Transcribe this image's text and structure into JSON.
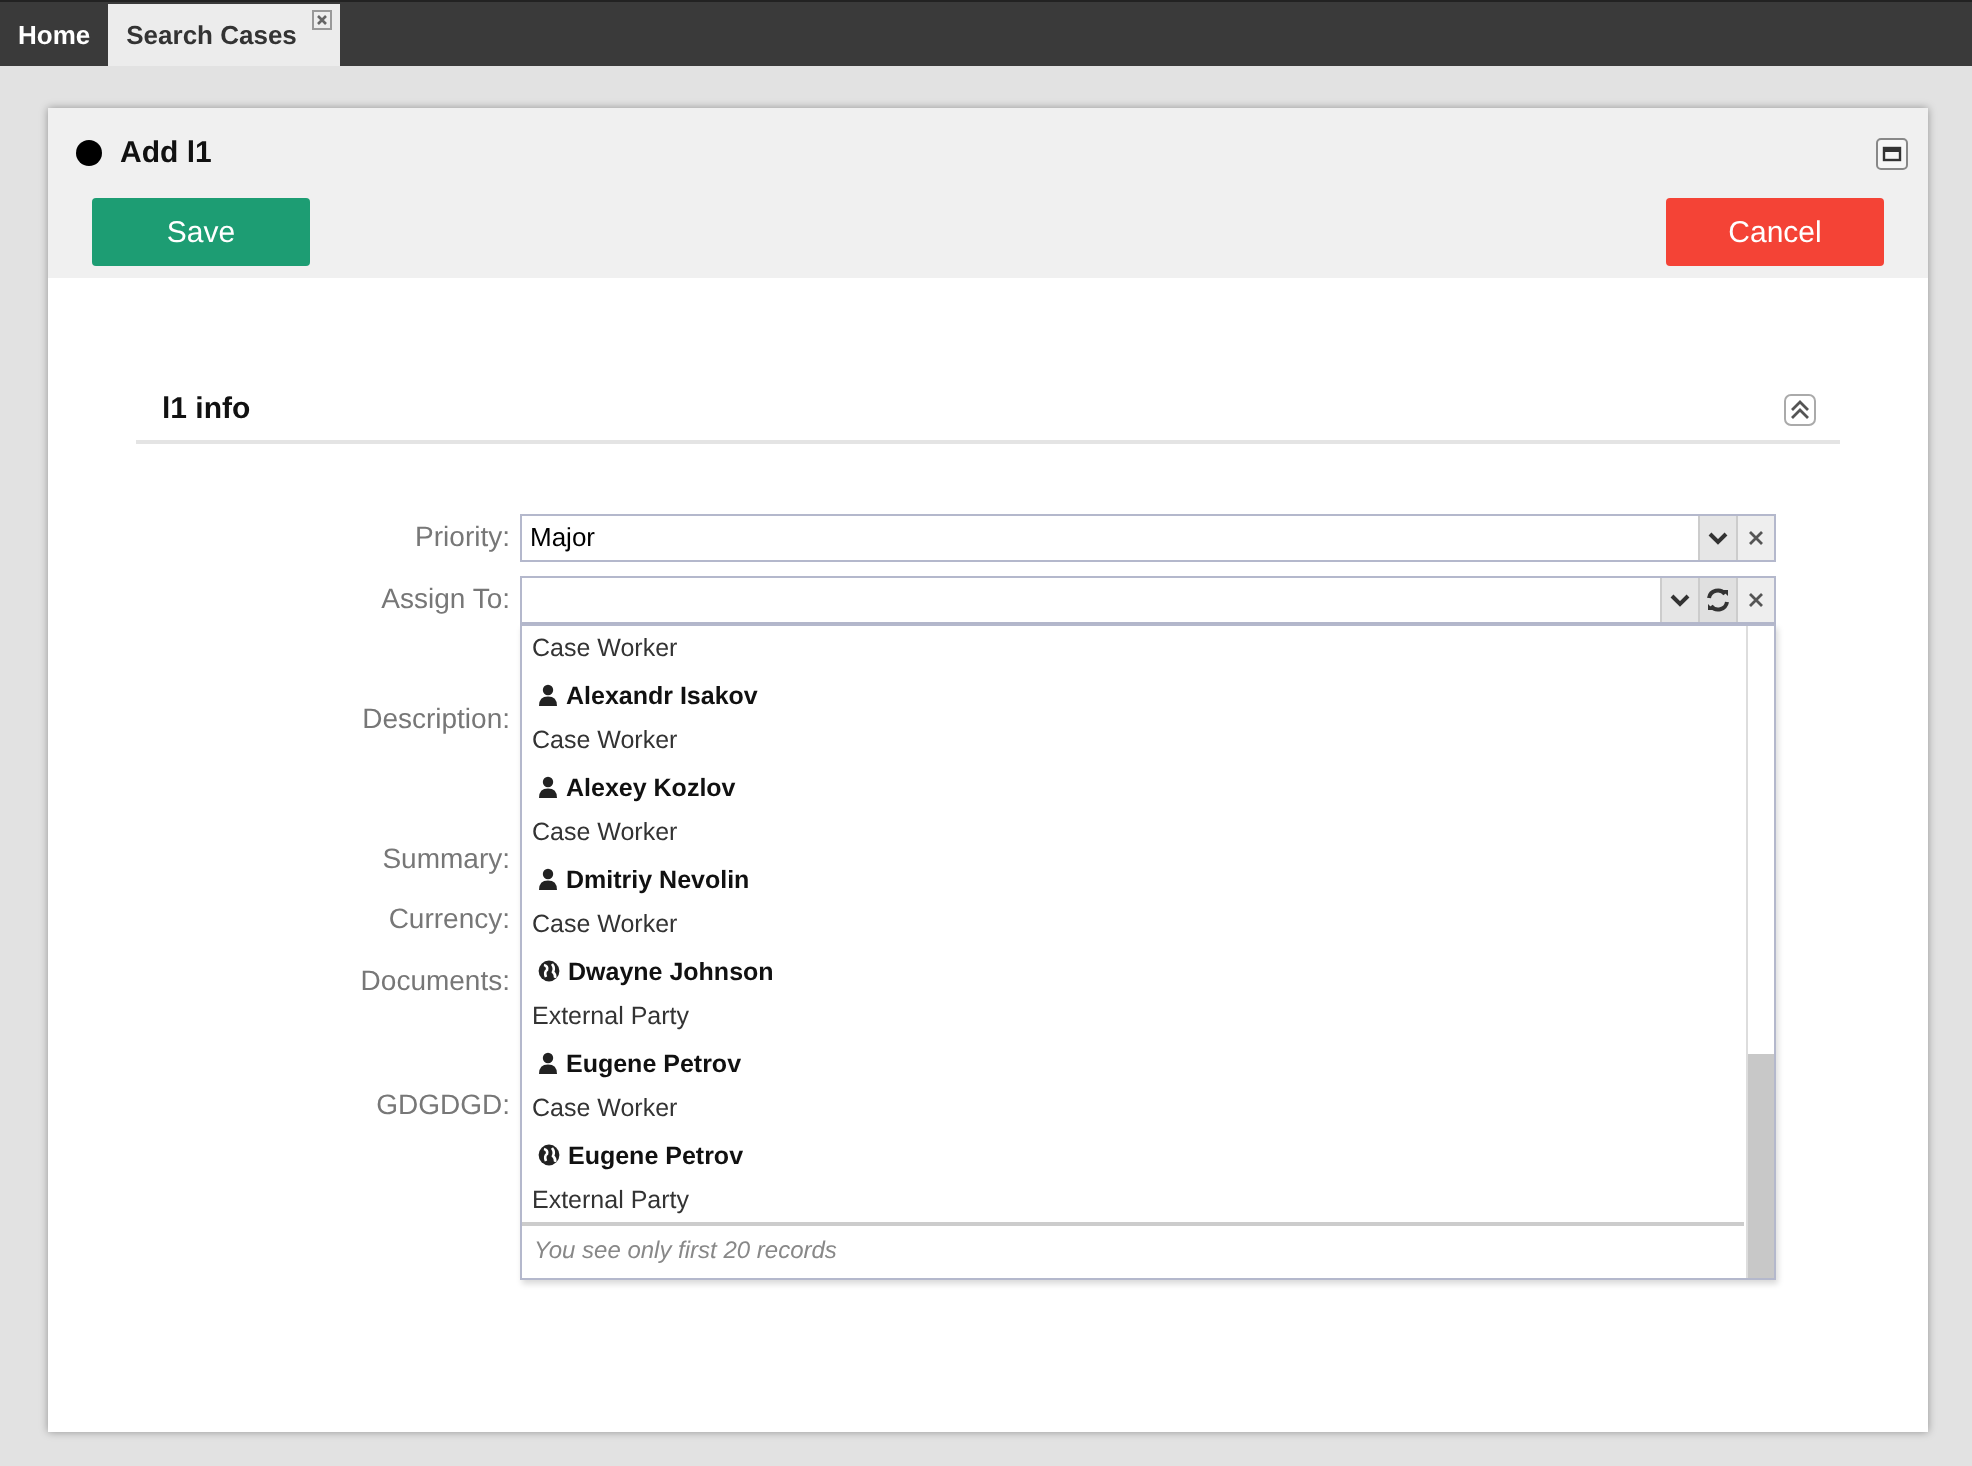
{
  "tabs": [
    {
      "label": "Home",
      "selected": false,
      "closable": false
    },
    {
      "label": "Search Cases",
      "selected": true,
      "closable": true
    }
  ],
  "dialog": {
    "title": "Add l1",
    "buttons": [
      {
        "label": "Save",
        "kind": "primary"
      },
      {
        "label": "Cancel",
        "kind": "danger"
      }
    ]
  },
  "section": {
    "title": "l1 info",
    "expanded": true
  },
  "fields": [
    {
      "label": "Priority:",
      "kind": "select",
      "value": "Major"
    },
    {
      "label": "Assign To:",
      "kind": "lookup"
    },
    {
      "label": "Description:",
      "kind": "textarea"
    },
    {
      "label": "Summary:",
      "kind": "text"
    },
    {
      "label": "Currency:",
      "kind": "money"
    },
    {
      "label": "Documents:",
      "kind": "file"
    },
    {
      "label": "GDGDGD:",
      "kind": "text"
    }
  ],
  "dropdown": {
    "options": [
      {
        "role": "Case Worker"
      },
      {
        "name": "Alexandr Isakov",
        "kind": "user",
        "role": "Case Worker"
      },
      {
        "name": "Alexey Kozlov",
        "kind": "user",
        "role": "Case Worker"
      },
      {
        "name": "Dmitriy Nevolin",
        "kind": "user",
        "role": "Case Worker"
      },
      {
        "name": "Dwayne Johnson",
        "kind": "external",
        "role": "External Party"
      },
      {
        "name": "Eugene Petrov",
        "kind": "user",
        "role": "Case Worker"
      },
      {
        "name": "Eugene Petrov",
        "kind": "external",
        "role": "External Party"
      }
    ],
    "footer": "You see only first 20 records"
  }
}
